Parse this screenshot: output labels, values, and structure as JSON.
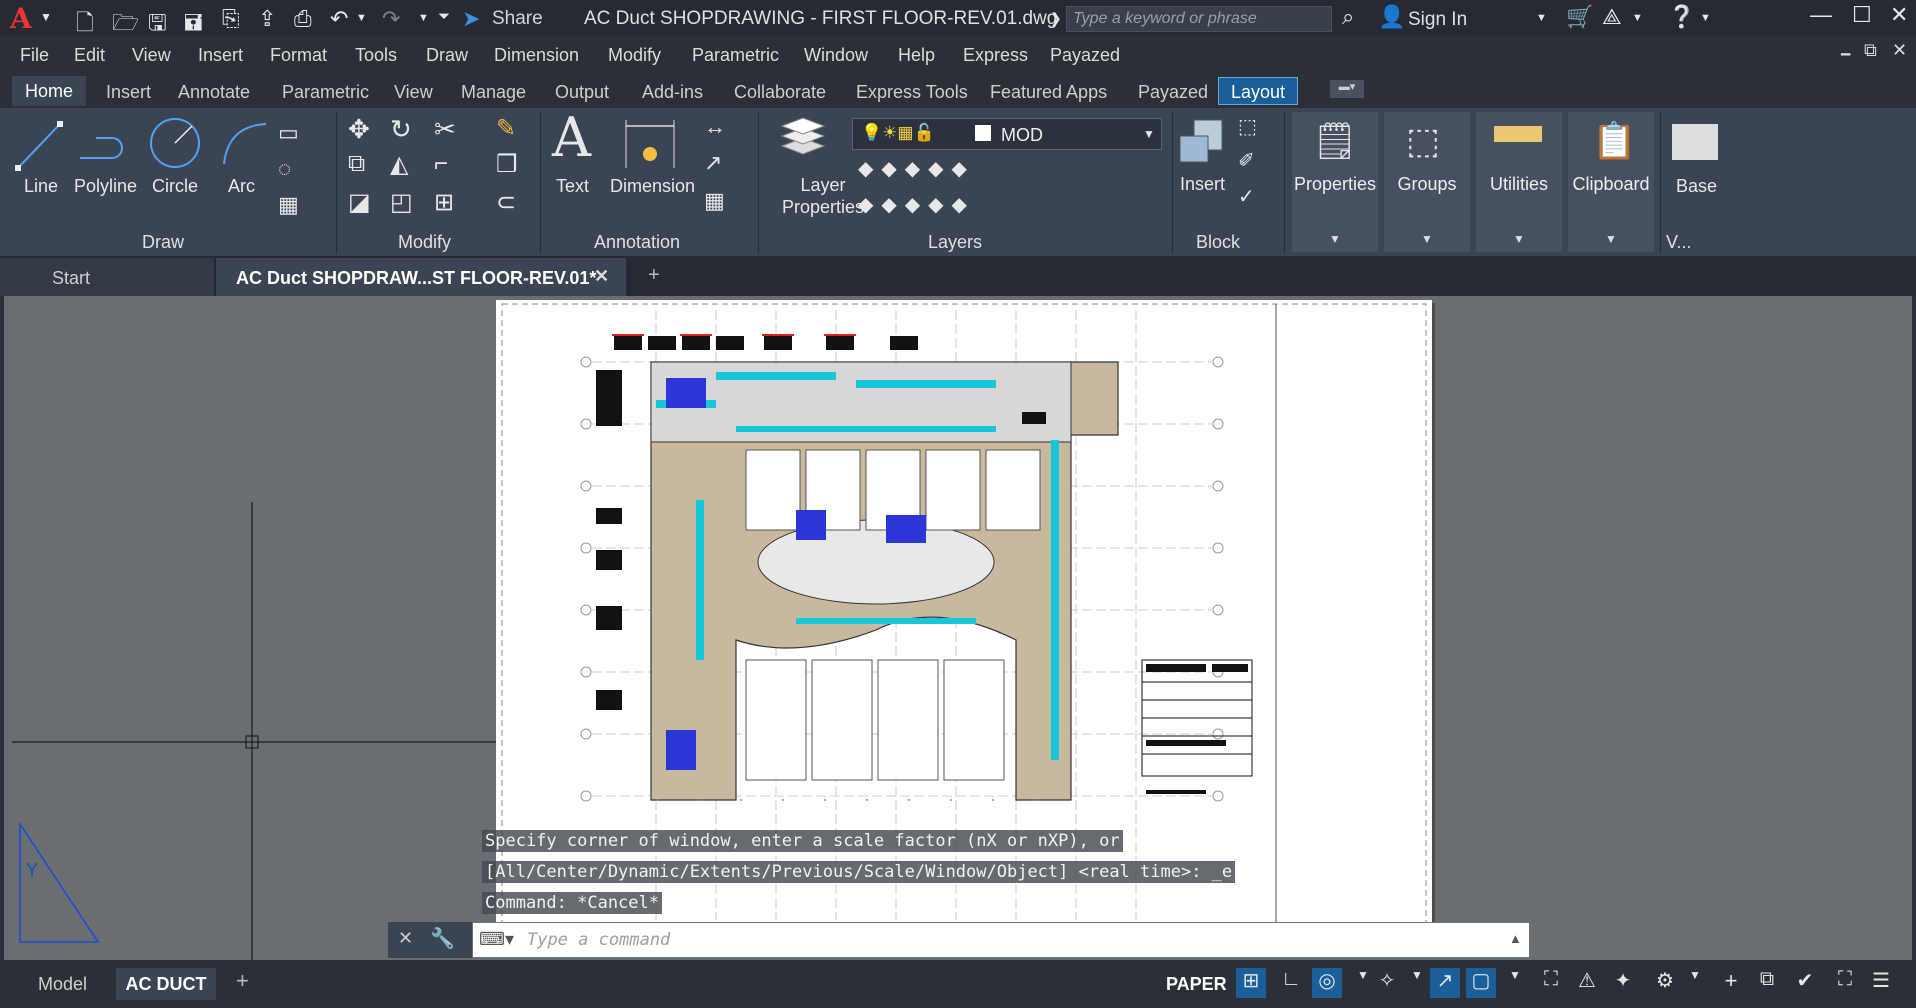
{
  "app": {
    "share_label": "Share",
    "document_title": "AC Duct SHOPDRAWING - FIRST FLOOR-REV.01.dwg",
    "search_placeholder": "Type a keyword or phrase",
    "sign_in_label": "Sign In"
  },
  "menu": [
    "File",
    "Edit",
    "View",
    "Insert",
    "Format",
    "Tools",
    "Draw",
    "Dimension",
    "Modify",
    "Parametric",
    "Window",
    "Help",
    "Express",
    "Payazed"
  ],
  "ribbon_tabs": [
    "Home",
    "Insert",
    "Annotate",
    "Parametric",
    "View",
    "Manage",
    "Output",
    "Add-ins",
    "Collaborate",
    "Express Tools",
    "Featured Apps",
    "Payazed",
    "Layout"
  ],
  "active_ribbon_tab": "Home",
  "ribbon": {
    "draw_tools": [
      "Line",
      "Polyline",
      "Circle",
      "Arc"
    ],
    "draw_group": "Draw",
    "modify_group": "Modify",
    "text_label": "Text",
    "dimension_label": "Dimension",
    "annotation_group": "Annotation",
    "layer_properties_label": "Layer\nProperties",
    "layer_properties_line1": "Layer",
    "layer_properties_line2": "Properties",
    "current_layer": "MOD",
    "layers_group": "Layers",
    "insert_label": "Insert",
    "block_group": "Block",
    "properties_label": "Properties",
    "groups_label": "Groups",
    "utilities_label": "Utilities",
    "clipboard_label": "Clipboard",
    "base_label": "Base",
    "view_group": "V..."
  },
  "file_tabs": {
    "start": "Start",
    "active_file": "AC Duct SHOPDRAW...ST FLOOR-REV.01*"
  },
  "command": {
    "history": [
      "Specify corner of window, enter a scale factor (nX or nXP), or",
      "[All/Center/Dynamic/Extents/Previous/Scale/Window/Object] <real time>: _e",
      "Command: *Cancel*"
    ],
    "placeholder": "Type a command"
  },
  "status": {
    "model_tab": "Model",
    "layout_tab": "AC DUCT",
    "space": "PAPER"
  },
  "colors": {
    "ribbon_bg": "#3b4453",
    "accent": "#1b5f9a",
    "viewport_bg": "#6a6e73"
  }
}
